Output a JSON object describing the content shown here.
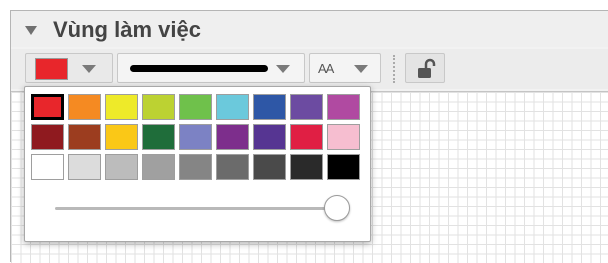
{
  "panel": {
    "title": "Vùng làm việc"
  },
  "toolbar": {
    "current_color": "#e8262b",
    "font_button_label": "AA",
    "color_dropdown_icon": "chevron-down-icon",
    "lock_icon": "unlock-icon"
  },
  "color_popup": {
    "selected_index": 0,
    "colors": [
      "#e8262b",
      "#f58a22",
      "#eeea29",
      "#bcd232",
      "#6fc14b",
      "#6bc9dc",
      "#2e57a6",
      "#6c4ba1",
      "#b04aa1",
      "#8f1a1f",
      "#9c3d1f",
      "#fac817",
      "#1f6d3a",
      "#7c82c4",
      "#7d2e8c",
      "#563592",
      "#e01f44",
      "#f6bed0",
      "#ffffff",
      "#dcdcdc",
      "#bcbcbc",
      "#a0a0a0",
      "#858585",
      "#6b6b6b",
      "#4a4a4a",
      "#2a2a2a",
      "#000000"
    ],
    "opacity_slider_value": 1.0
  }
}
